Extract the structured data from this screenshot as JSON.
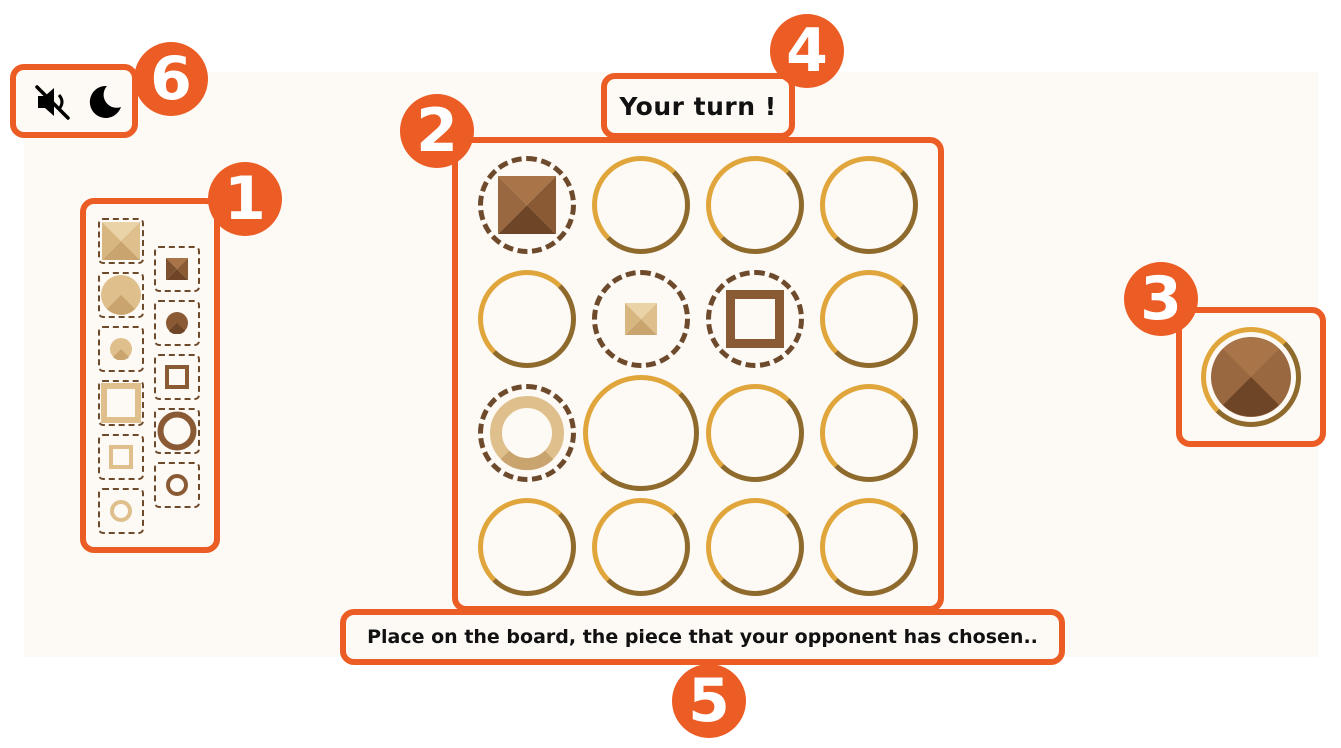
{
  "header": {
    "mute_icon": "volume-mute-icon",
    "theme_icon": "moon-icon"
  },
  "badges": {
    "available": "1",
    "board": "2",
    "selected": "3",
    "turn": "4",
    "message": "5",
    "controls": "6"
  },
  "turn_label": "Your turn !",
  "message": "Place on the board, the piece that your opponent has chosen..",
  "colors": {
    "highlight": "#ec5d25",
    "light_wood": "#dfc08c",
    "dark_wood": "#8a5a34",
    "ring_gold": "#e0a63c",
    "dashed": "#6e4a2d",
    "background": "#fdf9f4"
  },
  "available_pieces": [
    {
      "color": "light",
      "size": "large",
      "shape": "square",
      "fill": "solid"
    },
    {
      "color": "dark",
      "size": "small",
      "shape": "square",
      "fill": "solid"
    },
    {
      "color": "light",
      "size": "large",
      "shape": "round",
      "fill": "solid"
    },
    {
      "color": "dark",
      "size": "small",
      "shape": "round",
      "fill": "solid"
    },
    {
      "color": "light",
      "size": "small",
      "shape": "round",
      "fill": "solid"
    },
    {
      "color": "dark",
      "size": "small",
      "shape": "square",
      "fill": "hollow"
    },
    {
      "color": "light",
      "size": "large",
      "shape": "square",
      "fill": "hollow"
    },
    {
      "color": "dark",
      "size": "large",
      "shape": "round",
      "fill": "hollow"
    },
    {
      "color": "light",
      "size": "small",
      "shape": "square",
      "fill": "hollow"
    },
    {
      "color": "dark",
      "size": "small",
      "shape": "round",
      "fill": "hollow"
    },
    {
      "color": "light",
      "size": "small",
      "shape": "round",
      "fill": "hollow"
    }
  ],
  "board": [
    [
      "dark-large-square-solid",
      "empty",
      "empty",
      "empty"
    ],
    [
      "empty",
      "light-small-square-solid",
      "dark-large-square-hollow",
      "empty"
    ],
    [
      "light-large-round-hollow",
      "empty-highlighted",
      "empty",
      "empty"
    ],
    [
      "empty",
      "empty",
      "empty",
      "empty"
    ]
  ],
  "selected_piece": {
    "color": "dark",
    "size": "large",
    "shape": "round",
    "fill": "solid"
  }
}
